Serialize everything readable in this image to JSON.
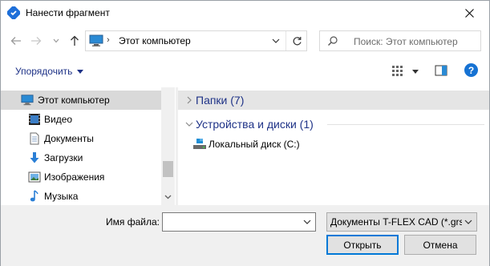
{
  "window": {
    "title": "Нанести фрагмент",
    "close_glyph": "✕"
  },
  "nav": {
    "address_path": "Этот компьютер",
    "address_separator": "›",
    "search_placeholder": "Поиск: Этот компьютер"
  },
  "toolbar": {
    "organize_label": "Упорядочить",
    "help_label": "?"
  },
  "sidebar": {
    "items": [
      {
        "label": "Этот компьютер",
        "icon": "computer-icon",
        "selected": true
      },
      {
        "label": "Видео",
        "icon": "video-icon",
        "selected": false
      },
      {
        "label": "Документы",
        "icon": "documents-icon",
        "selected": false
      },
      {
        "label": "Загрузки",
        "icon": "downloads-icon",
        "selected": false
      },
      {
        "label": "Изображения",
        "icon": "pictures-icon",
        "selected": false
      },
      {
        "label": "Музыка",
        "icon": "music-icon",
        "selected": false
      }
    ]
  },
  "content": {
    "groups": [
      {
        "label": "Папки (7)",
        "expanded": false
      },
      {
        "label": "Устройства и диски (1)",
        "expanded": true
      }
    ],
    "drives": [
      {
        "label": "Локальный диск (C:)",
        "icon": "local-disk-icon"
      }
    ]
  },
  "footer": {
    "filename_label": "Имя файла:",
    "filename_value": "",
    "filetype_value": "Документы T-FLEX CAD (*.grs,",
    "open_label": "Открыть",
    "cancel_label": "Отмена"
  },
  "colors": {
    "accent": "#1e3287",
    "selection": "#d9d9d9",
    "footer_bg": "#f0f0f0",
    "primary_border": "#0078d7"
  }
}
